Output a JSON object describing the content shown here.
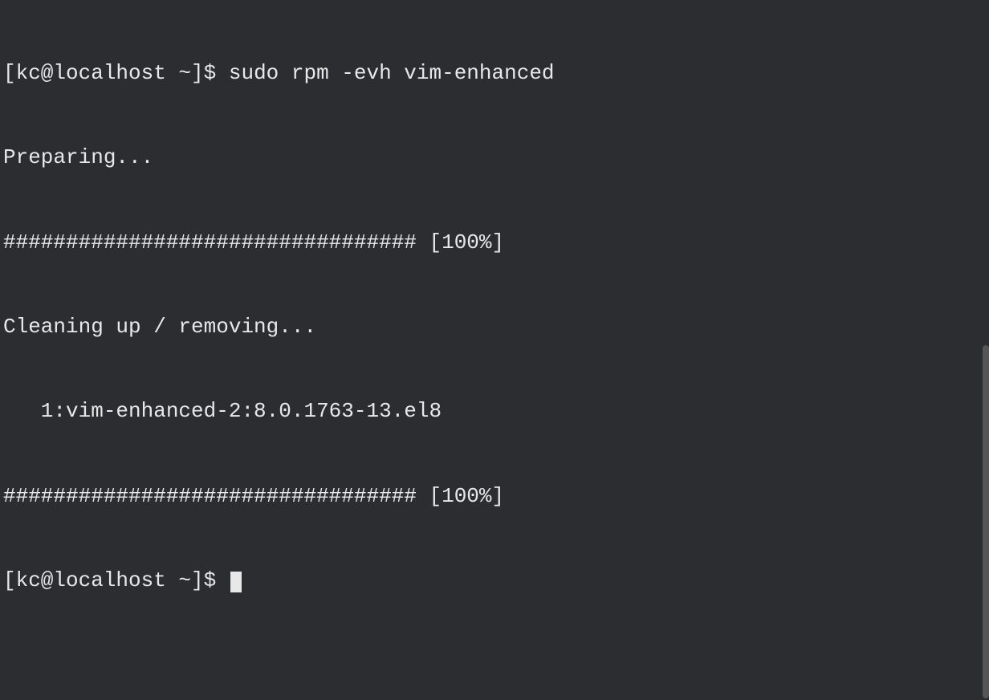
{
  "terminal": {
    "prompt1": "[kc@localhost ~]$ ",
    "command1": "sudo rpm -evh vim-enhanced",
    "line2": "Preparing...",
    "line3": "################################# [100%]",
    "line4": "Cleaning up / removing...",
    "line5": "   1:vim-enhanced-2:8.0.1763-13.el8",
    "line6": "################################# [100%]",
    "prompt2": "[kc@localhost ~]$ "
  }
}
